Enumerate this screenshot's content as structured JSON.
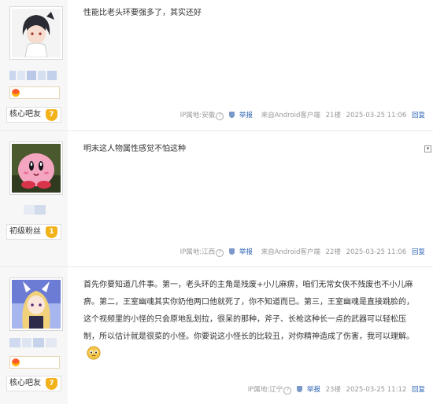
{
  "posts": [
    {
      "rank_label": "核心吧友",
      "level": "7",
      "content": "性能比老头环要强多了，其实还好",
      "ip": "IP属地:安徽",
      "report": "举报",
      "client": "来自Android客户端",
      "floor": "21楼",
      "time": "2025-03-25 11:06",
      "reply": "回复"
    },
    {
      "rank_label": "初级粉丝",
      "level": "1",
      "content": "明末这人物属性感觉不怕这种",
      "ip": "IP属地:江西",
      "report": "举报",
      "client": "来自Android客户端",
      "floor": "22楼",
      "time": "2025-03-25 11:06",
      "reply": "回复"
    },
    {
      "rank_label": "核心吧友",
      "level": "7",
      "content": "首先你要知道几件事。第一，老头环的主角是残废+小儿麻痹，咱们无常女侠不残废也不小儿麻痹。第二，王室幽魂其实你奶他两口他就死了，你不知道而已。第三，王室幽魂是直接跳脸的，这个视频里的小怪的只会原地乱划拉，很呆的那种，斧子、长枪这种长一点的武器可以轻松压制，所以估计就是很菜的小怪。你要说这小怪长的比较丑，对你精神造成了伤害，我可以理解。",
      "ip": "IP属地:辽宁",
      "report": "举报",
      "client": "",
      "floor": "23楼",
      "time": "2025-03-25 11:12",
      "reply": "回复"
    }
  ],
  "icons": {
    "collapse": "collapse-icon",
    "question": "question-icon",
    "shield": "shield-icon",
    "emoji": "emoji-icon"
  },
  "colors": {
    "link_blue": "#2d64b3",
    "meta_gray": "#999999",
    "sidebar_bg": "#f7f7f7",
    "level_gold": "#f2b21a"
  }
}
